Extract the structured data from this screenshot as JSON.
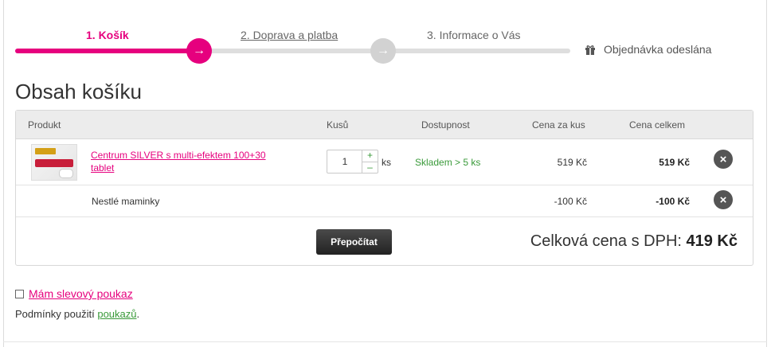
{
  "steps": [
    {
      "label": "1. Košík",
      "state": "active"
    },
    {
      "label": "2. Doprava a platba",
      "state": "link"
    },
    {
      "label": "3. Informace o Vás",
      "state": "plain"
    },
    {
      "label": "Objednávka odeslána",
      "state": "final",
      "icon": "gift-icon"
    }
  ],
  "step_arrow_icon": "→",
  "page_title": "Obsah košíku",
  "cart": {
    "columns": {
      "product": "Produkt",
      "qty": "Kusů",
      "availability": "Dostupnost",
      "unit_price": "Cena za kus",
      "total_price": "Cena celkem"
    },
    "items": [
      {
        "name": "Centrum SILVER s multi-efektem 100+30 tablet",
        "quantity": "1",
        "unit": "ks",
        "availability": "Skladem > 5 ks",
        "unit_price": "519 Kč",
        "total_price": "519 Kč",
        "image_icon": "product-image"
      }
    ],
    "discount": {
      "name": "Nestlé maminky",
      "unit_price": "-100 Kč",
      "total_price": "-100 Kč"
    },
    "qty_plus": "+",
    "qty_minus": "–",
    "remove_icon": "×",
    "recalc_label": "Přepočítat",
    "grand_label": "Celková cena s DPH:",
    "grand_value": "419 Kč"
  },
  "voucher": {
    "label": "Mám slevový poukaz",
    "checked": false
  },
  "terms": {
    "prefix": "Podmínky použití",
    "link": "poukazů",
    "suffix": "."
  },
  "colors": {
    "accent": "#e6007e",
    "success": "#3a9a3a",
    "inactive": "#d2d2d2"
  }
}
